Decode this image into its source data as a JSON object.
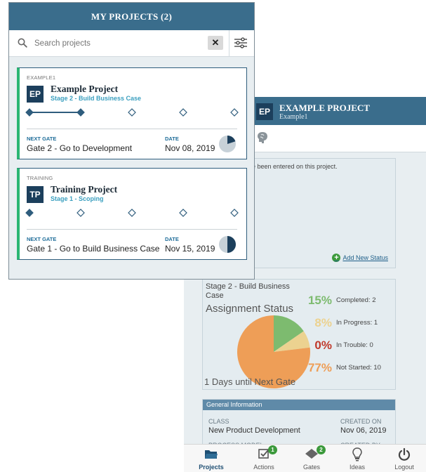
{
  "list_panel": {
    "title": "MY PROJECTS (2)",
    "search_placeholder": "Search projects",
    "clear_label": "✕",
    "projects": [
      {
        "category": "EXAMPLE1",
        "initials": "EP",
        "name": "Example Project",
        "stage": "Stage 2 - Build Business Case",
        "stage_progress": 2,
        "next_gate_label": "NEXT GATE",
        "next_gate": "Gate 2 - Go to Development",
        "date_label": "DATE",
        "date": "Nov 08, 2019",
        "gauge_fraction": 0.2
      },
      {
        "category": "TRAINING",
        "initials": "TP",
        "name": "Training Project",
        "stage": "Stage 1 - Scoping",
        "stage_progress": 1,
        "next_gate_label": "NEXT GATE",
        "next_gate": "Gate 1 - Go to Build Business Case",
        "date_label": "DATE",
        "date": "Nov 15, 2019",
        "gauge_fraction": 0.5
      }
    ]
  },
  "detail_panel": {
    "initials": "EP",
    "title": "EXAMPLE PROJECT",
    "subtitle": "Example1",
    "status_message": "e been entered on this project.",
    "add_status_label": "Add New Status",
    "assignment": {
      "stage": "Stage 2 - Build Business Case",
      "title": "Assignment Status",
      "days_to_gate": "1 Days until Next Gate",
      "stats": [
        {
          "pct": "15%",
          "label": "Completed: 2",
          "color": "#7dbb6f"
        },
        {
          "pct": "8%",
          "label": "In Progress: 1",
          "color": "#ecd290"
        },
        {
          "pct": "0%",
          "label": "In Trouble: 0",
          "color": "#c0392b"
        },
        {
          "pct": "77%",
          "label": "Not Started: 10",
          "color": "#ee9e57"
        }
      ],
      "pie_values": [
        2,
        1,
        0,
        10
      ]
    },
    "general": {
      "header": "General Information",
      "class_label": "CLASS",
      "class_value": "New Product Development",
      "created_on_label": "CREATED ON",
      "created_on_value": "Nov 06, 2019",
      "process_model_label": "PROCESS MODEL",
      "created_by_label": "CREATED BY"
    }
  },
  "bottom_nav": [
    {
      "label": "Projects",
      "icon": "folder-icon",
      "active": true,
      "badge": ""
    },
    {
      "label": "Actions",
      "icon": "checkbox-icon",
      "active": false,
      "badge": "1"
    },
    {
      "label": "Gates",
      "icon": "diamond-icon",
      "active": false,
      "badge": "2"
    },
    {
      "label": "Ideas",
      "icon": "lightbulb-icon",
      "active": false,
      "badge": ""
    },
    {
      "label": "Logout",
      "icon": "power-icon",
      "active": false,
      "badge": ""
    }
  ],
  "colors": {
    "header": "#3a6d8c",
    "accent_green": "#2bb673",
    "badge_navy": "#1c3f5c",
    "stage_teal": "#3a9fbf"
  }
}
